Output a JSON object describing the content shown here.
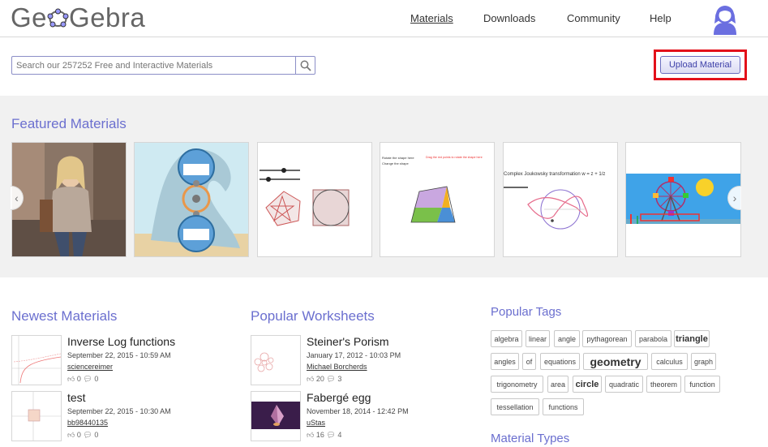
{
  "header": {
    "logo_text_pre": "Ge",
    "logo_text_post": "Gebra",
    "nav": [
      {
        "label": "Materials",
        "active": true
      },
      {
        "label": "Downloads",
        "active": false
      },
      {
        "label": "Community",
        "active": false
      },
      {
        "label": "Help",
        "active": false
      }
    ],
    "avatar_icon": "user-avatar-icon"
  },
  "search": {
    "placeholder": "Search our 257252 Free and Interactive Materials",
    "button_icon": "search-icon"
  },
  "upload": {
    "label": "Upload Material"
  },
  "featured": {
    "title": "Featured Materials",
    "thumb4_text1": "Rotate the shape here",
    "thumb4_text2": "Change the shape",
    "thumb4_red": "Drag the red points to rotate the shape here",
    "thumb5_text": "Complex Joukowsky transformation w = z + 1/z"
  },
  "newest": {
    "title": "Newest Materials",
    "items": [
      {
        "title": "Inverse Log functions",
        "date": "September 22, 2015 - 10:59 AM",
        "author": "sciencereimer",
        "likes": "0",
        "comments": "0"
      },
      {
        "title": "test",
        "date": "September 22, 2015 - 10:30 AM",
        "author": "bb98440135",
        "likes": "0",
        "comments": "0"
      }
    ]
  },
  "worksheets": {
    "title": "Popular Worksheets",
    "items": [
      {
        "title": "Steiner's Porism",
        "date": "January 17, 2012 - 10:03 PM",
        "author": "Michael Borcherds",
        "likes": "20",
        "comments": "3"
      },
      {
        "title": "Fabergé egg",
        "date": "November 18, 2014 - 12:42 PM",
        "author": "uStas",
        "likes": "16",
        "comments": "4"
      }
    ]
  },
  "tags": {
    "title": "Popular Tags",
    "rows": [
      [
        "algebra",
        "linear",
        "angle",
        "pythagorean",
        "parabola",
        "triangle"
      ],
      [
        "angles",
        "of",
        "equations",
        "geometry",
        "calculus",
        "graph"
      ],
      [
        "trigonometry",
        "area",
        "circle",
        "quadratic",
        "theorem",
        "function"
      ],
      [
        "tessellation",
        "functions"
      ]
    ]
  },
  "material_types": {
    "title": "Material Types"
  },
  "colors": {
    "accent": "#6b6fcf",
    "highlight": "#e3111a"
  }
}
